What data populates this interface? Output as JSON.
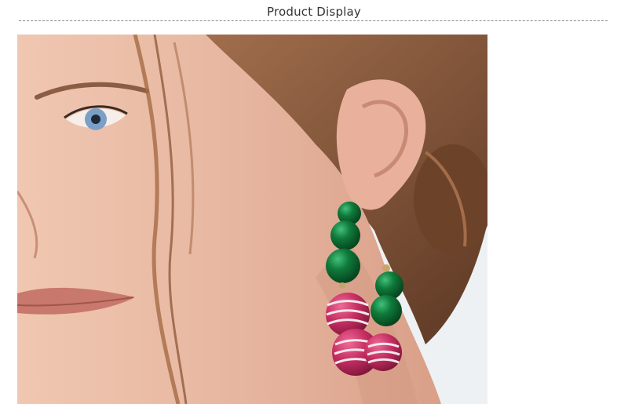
{
  "header": {
    "title": "Product Display"
  },
  "photo": {
    "subject": "earring-model-photo",
    "colors": {
      "background": "#eef1f3",
      "skin": "#e7b9a2",
      "hair": "#8a5a3c",
      "green_bead": "#0f7a3a",
      "pink_bead": "#c62e63",
      "stripe": "#f4e8ea",
      "gold": "#c9a46a"
    }
  }
}
